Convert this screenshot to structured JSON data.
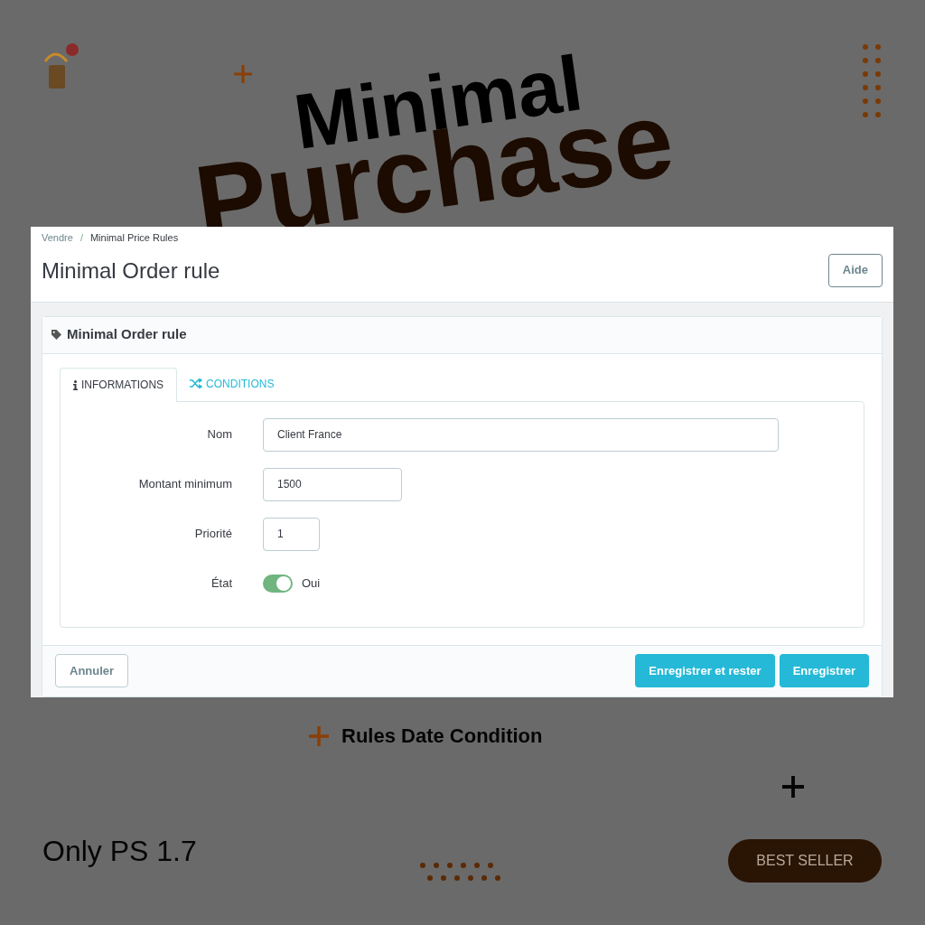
{
  "poster": {
    "headline_1": "Minimal",
    "headline_2": "Purchase",
    "features": [
      {
        "label": "Rules Date Condition"
      }
    ],
    "version": "Only PS 1.7",
    "badge": "BEST SELLER"
  },
  "screen": {
    "breadcrumb": [
      {
        "label": "Vendre"
      },
      {
        "label": "Minimal Price Rules"
      }
    ],
    "breadcrumb_separator": "/",
    "title": "Minimal Order rule",
    "help_button": "Aide",
    "panel": {
      "title": "Minimal Order rule",
      "tabs": [
        {
          "label": "INFORMATIONS",
          "selected": true
        },
        {
          "label": "CONDITIONS",
          "selected": false
        }
      ],
      "fields": [
        {
          "kind": "text",
          "label": "Nom",
          "value": "Client France"
        },
        {
          "kind": "text",
          "label": "Montant minimum",
          "value": "1500"
        },
        {
          "kind": "text",
          "label": "Priorité",
          "value": "1"
        },
        {
          "kind": "switch",
          "label": "État",
          "on": true,
          "value": "Oui"
        }
      ],
      "cancel_button": "Annuler",
      "save_buttons": [
        "Enregistrer et rester",
        "Enregistrer"
      ]
    }
  }
}
